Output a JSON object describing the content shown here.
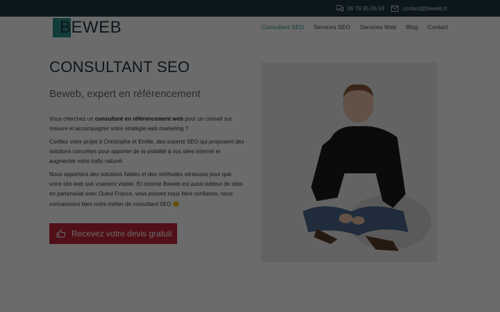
{
  "topbar": {
    "phone": "06 78 95 06 63",
    "email": "contact@beweb.fr",
    "phone_icon": "chat-bubbles-icon",
    "email_icon": "envelope-icon"
  },
  "header": {
    "logo_text": "BEWEB",
    "nav": [
      {
        "label": "Consultant SEO",
        "active": true
      },
      {
        "label": "Services SEO"
      },
      {
        "label": "Services Web"
      },
      {
        "label": "Blog"
      },
      {
        "label": "Contact"
      }
    ]
  },
  "main": {
    "title": "CONSULTANT SEO",
    "subtitle": "Beweb, expert en référencement",
    "p1_a": "Vous cherchez un ",
    "p1_b": "consultant en référencement web",
    "p1_c": " pour un conseil sur mesure et accompagner votre stratégie web marketing ?",
    "p2": "Confiez votre projet à Christophe et Emilie, des experts SEO qui proposent des solutions concrètes pour apporter de la visibilité à vos sites internet et augmenter votre trafic naturel.",
    "p3": "Nous apportons des solutions fiables et des méthodes sérieuses pour que votre site web soit vraiment visible. Et comme Beweb est aussi éditeur de sites en partenariat avec Ouest France, vous pouvez nous faire confiance, nous connaissons bien notre métier de consultant SEO 🙂",
    "cta_label": "Recevez votre devis gratuit",
    "cta_icon": "thumbs-up-icon"
  },
  "colors": {
    "accent": "#2d8f8a",
    "navy": "#1e3547",
    "cta": "#c0283b"
  }
}
